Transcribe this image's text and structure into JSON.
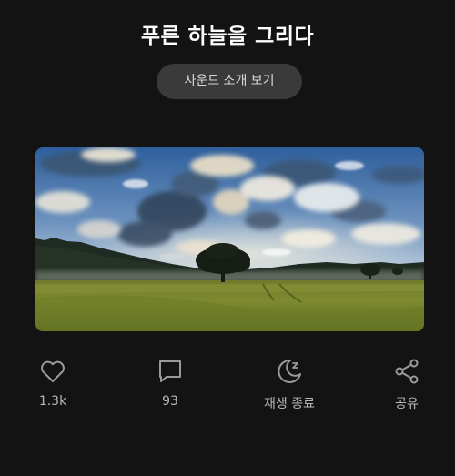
{
  "page": {
    "title": "푸른 하늘을 그리다",
    "intro_button_label": "사운드 소개 보기"
  },
  "artwork": {
    "alt": "푸른 하늘을 그리다"
  },
  "actions": [
    {
      "icon": "heart-icon",
      "label": "1.3k"
    },
    {
      "icon": "comment-icon",
      "label": "93"
    },
    {
      "icon": "moon-sleep-icon",
      "label": "재생 종료"
    },
    {
      "icon": "share-icon",
      "label": "공유"
    }
  ],
  "colors": {
    "background": "#131313",
    "button_bg": "#3a3a3a",
    "icon": "#9a9a9a",
    "label": "#b8b8b8"
  }
}
